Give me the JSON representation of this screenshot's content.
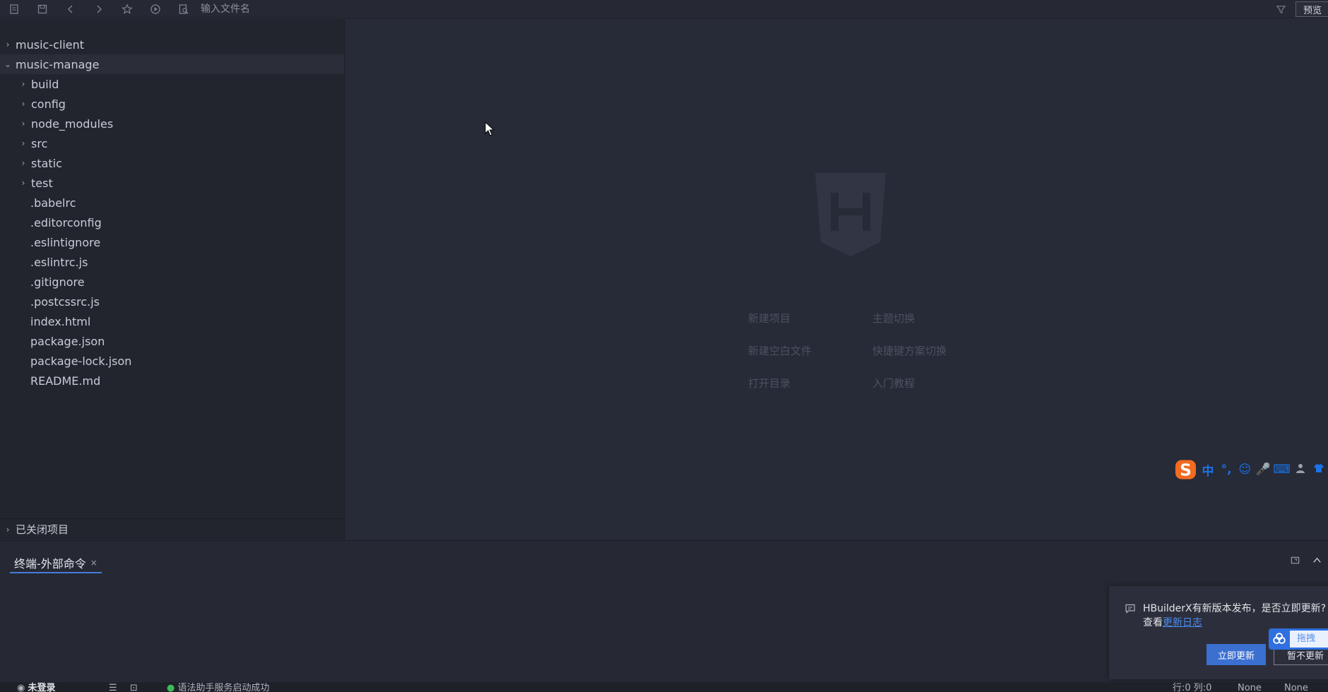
{
  "toolbar": {
    "search_placeholder": "输入文件名",
    "preview_label": "预览"
  },
  "sidebar": {
    "projects": [
      {
        "name": "music-client",
        "expanded": false
      },
      {
        "name": "music-manage",
        "expanded": true
      }
    ],
    "folders": [
      "build",
      "config",
      "node_modules",
      "src",
      "static",
      "test"
    ],
    "files": [
      ".babelrc",
      ".editorconfig",
      ".eslintignore",
      ".eslintrc.js",
      ".gitignore",
      ".postcssrc.js",
      "index.html",
      "package.json",
      "package-lock.json",
      "README.md"
    ],
    "closed_projects_label": "已关闭项目"
  },
  "welcome": {
    "links": [
      "新建项目",
      "主题切换",
      "新建空白文件",
      "快捷键方案切换",
      "打开目录",
      "入门教程"
    ]
  },
  "ime": {
    "items": [
      "中",
      "°,",
      "☺",
      "🎤",
      "⌨"
    ]
  },
  "panel": {
    "tab_label": "终端-外部命令",
    "close_glyph": "×"
  },
  "notification": {
    "message": "HBuilderX有新版本发布，是否立即更新?",
    "view_prefix": "查看",
    "changelog_link": "更新日志",
    "update_button": "立即更新",
    "later_button": "暂不更新"
  },
  "baidu_widget": {
    "label": "拖拽"
  },
  "statusbar": {
    "login": "未登录",
    "language_service": "语法助手服务启动成功",
    "position": "行:0  列:0",
    "encoding": "None",
    "syntax": "None"
  },
  "colors": {
    "accent": "#3b6fd0",
    "link": "#4a8cf0",
    "status_ok": "#3cba54"
  }
}
